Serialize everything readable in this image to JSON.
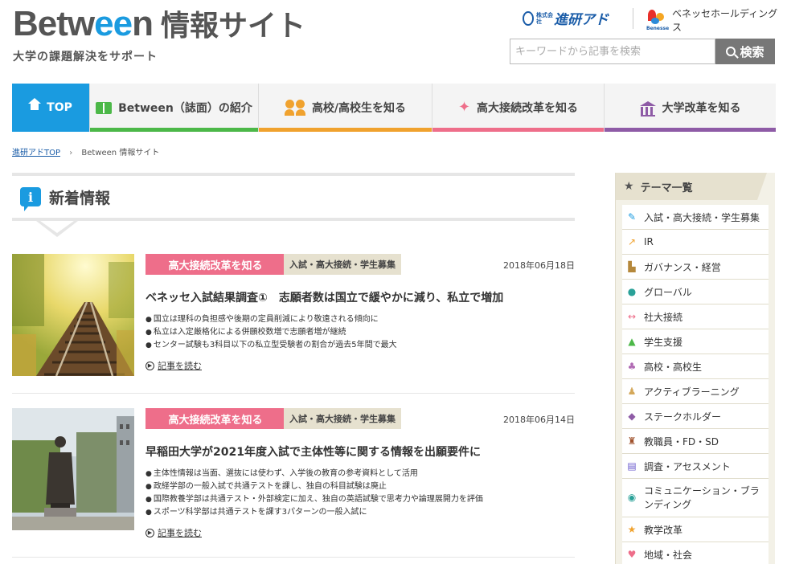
{
  "header": {
    "logo_main": "Betw",
    "logo_ee": "ee",
    "logo_end": "n",
    "logo_sub": "情報サイト",
    "tagline": "大学の課題解決をサポート",
    "partner1_small": "株式会社",
    "partner1_name": "進研アド",
    "partner2_mark": "Benesse",
    "partner2_name": "ベネッセホールディングス",
    "search_placeholder": "キーワードから記事を検索",
    "search_button": "検索"
  },
  "nav": {
    "items": [
      {
        "label": "TOP",
        "icon": "home-icon"
      },
      {
        "label": "Between（誌面）の紹介",
        "icon": "book-icon"
      },
      {
        "label": "高校/高校生を知る",
        "icon": "people-icon"
      },
      {
        "label": "高大接続改革を知る",
        "icon": "sparkle-icon"
      },
      {
        "label": "大学改革を知る",
        "icon": "building-icon"
      }
    ],
    "colors": {
      "top": "#1a9be0",
      "between": "#4cb848",
      "koko": "#f0a22e",
      "kodai": "#ee6e8a",
      "daigaku": "#8e5ba6"
    }
  },
  "breadcrumb": {
    "home": "進研アドTOP",
    "separator": "›",
    "current": "Between 情報サイト"
  },
  "news": {
    "title": "新着情報",
    "articles": [
      {
        "category": "高大接続改革を知る",
        "tag": "入試・高大接続・学生募集",
        "date": "2018年06月18日",
        "headline": "ベネッセ入試結果調査①　志願者数は国立で緩やかに減り、私立で増加",
        "bullets": [
          "国立は理科の負担感や後期の定員削減により敬遠される傾向に",
          "私立は入定厳格化による併願校数増で志願者増が継続",
          "センター試験も3科目以下の私立型受験者の割合が過去5年間で最大"
        ],
        "more": "記事を読む"
      },
      {
        "category": "高大接続改革を知る",
        "tag": "入試・高大接続・学生募集",
        "date": "2018年06月14日",
        "headline": "早稲田大学が2021年度入試で主体性等に関する情報を出願要件に",
        "bullets": [
          "主体性情報は当面、選抜には使わず、入学後の教育の参考資料として活用",
          "政経学部の一般入試で共通テストを課し、独自の科目試験は廃止",
          "国際教養学部は共通テスト・外部検定に加え、独自の英語試験で思考力や論理展開力を評価",
          "スポーツ科学部は共通テストを課す3パターンの一般入試に"
        ],
        "more": "記事を読む"
      }
    ]
  },
  "sidebar": {
    "title": "テーマ一覧",
    "items": [
      {
        "label": "入試・高大接続・学生募集",
        "icon": "pencil-icon",
        "color": "#1a9be0"
      },
      {
        "label": "IR",
        "icon": "chart-icon",
        "color": "#f0a22e"
      },
      {
        "label": "ガバナンス・経営",
        "icon": "building-icon",
        "color": "#b5883b"
      },
      {
        "label": "グローバル",
        "icon": "globe-icon",
        "color": "#2aa198"
      },
      {
        "label": "社大接続",
        "icon": "arrows-icon",
        "color": "#ee6e8a"
      },
      {
        "label": "学生支援",
        "icon": "person-icon",
        "color": "#4cb848"
      },
      {
        "label": "高校・高校生",
        "icon": "people-icon",
        "color": "#b06ab3"
      },
      {
        "label": "アクティブラーニング",
        "icon": "group-icon",
        "color": "#d4a85a"
      },
      {
        "label": "ステークホルダー",
        "icon": "handshake-icon",
        "color": "#8e5ba6"
      },
      {
        "label": "教職員・FD・SD",
        "icon": "staff-icon",
        "color": "#a0522d"
      },
      {
        "label": "調査・アセスメント",
        "icon": "document-icon",
        "color": "#6a5acd"
      },
      {
        "label": "コミュニケーション・ブランディング",
        "icon": "chat-icon",
        "color": "#2aa198"
      },
      {
        "label": "教学改革",
        "icon": "star-icon",
        "color": "#f0a22e"
      },
      {
        "label": "地域・社会",
        "icon": "heart-icon",
        "color": "#ee6e8a"
      }
    ]
  }
}
